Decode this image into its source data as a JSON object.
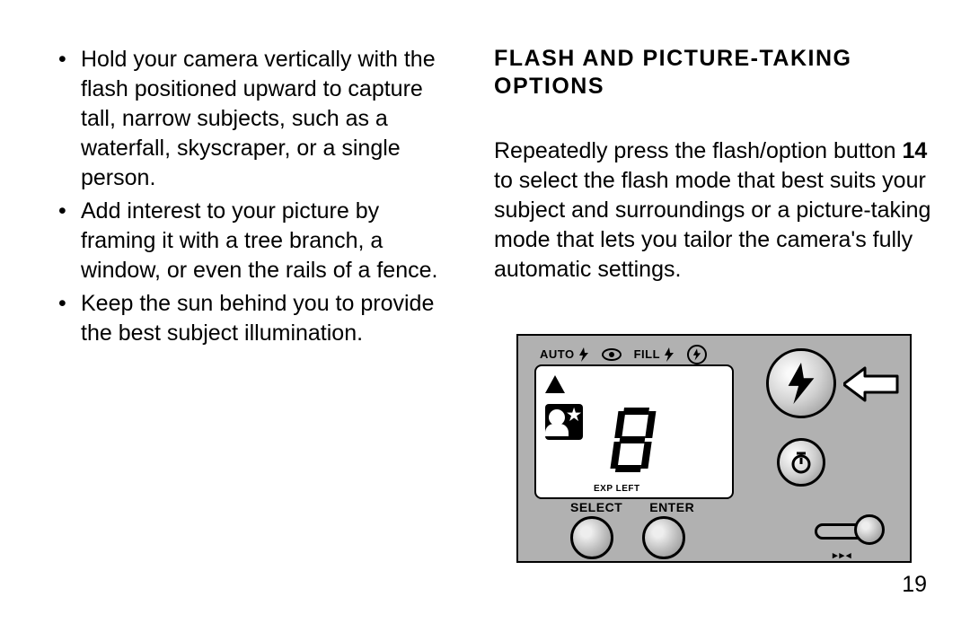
{
  "left": {
    "tips": [
      "Hold your camera vertically with the flash positioned upward to capture tall, narrow subjects, such as a waterfall, skyscraper, or a single person.",
      "Add interest to your picture by framing it with a tree branch, a window, or even the rails of a fence.",
      "Keep the sun behind you to provide the best subject illumination."
    ]
  },
  "right": {
    "heading": "FLASH AND PICTURE-TAKING OPTIONS",
    "paragraph_pre": "Repeatedly press the flash/option button ",
    "button_ref": "14",
    "paragraph_post": " to select the flash mode that best suits your subject and surroundings or a picture-taking mode that lets you tailor the camera's fully automatic settings."
  },
  "diagram": {
    "mode_auto": "AUTO",
    "mode_fill": "FILL",
    "exp_left": "EXP LEFT",
    "label_select": "SELECT",
    "label_enter": "ENTER",
    "digit": "8"
  },
  "page_number": "19"
}
